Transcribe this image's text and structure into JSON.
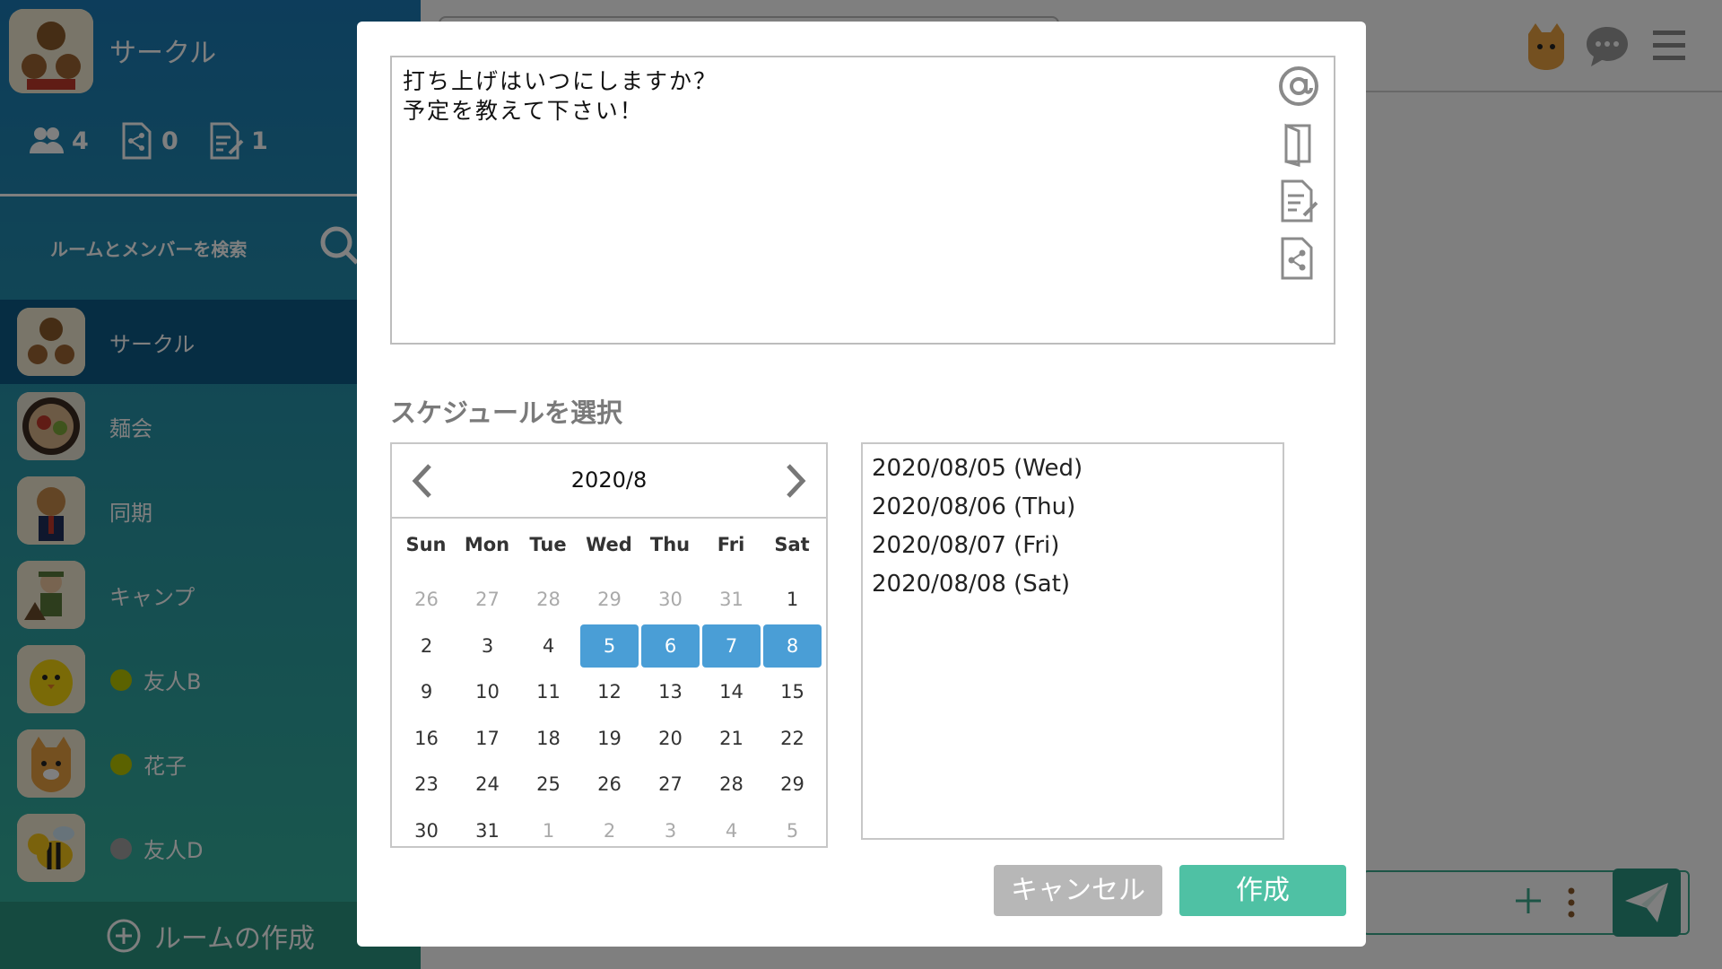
{
  "sidebar": {
    "circle_name": "サークル",
    "stats": {
      "members": "4",
      "shared_files": "0",
      "notes": "1"
    },
    "search_placeholder": "ルームとメンバーを検索",
    "rooms": [
      {
        "name": "サークル",
        "active": true,
        "icon": "bears-avatar"
      },
      {
        "name": "麺会",
        "active": false,
        "icon": "ramen-avatar"
      },
      {
        "name": "同期",
        "active": false,
        "icon": "dog-avatar"
      },
      {
        "name": "キャンプ",
        "active": false,
        "icon": "camper-avatar"
      },
      {
        "name": "友人B",
        "active": false,
        "icon": "chick-avatar",
        "status": "online"
      },
      {
        "name": "花子",
        "active": false,
        "icon": "cat-avatar",
        "status": "online"
      },
      {
        "name": "友人D",
        "active": false,
        "icon": "bee-avatar",
        "status": "offline"
      }
    ],
    "create_room_label": "ルームの作成"
  },
  "colors": {
    "accent_green": "#4fc1a4",
    "selected_blue": "#4a9ed6",
    "status_online": "#b7c400",
    "status_offline": "#a0a0a0"
  },
  "modal": {
    "message": "打ち上げはいつにしますか？\n予定を教えて下さい！",
    "tools": [
      "mention-icon",
      "exit-door-icon",
      "note-edit-icon",
      "share-file-icon"
    ],
    "schedule_heading": "スケジュールを選択",
    "calendar": {
      "month_label": "2020/8",
      "weekdays": [
        "Sun",
        "Mon",
        "Tue",
        "Wed",
        "Thu",
        "Fri",
        "Sat"
      ],
      "weeks": [
        [
          "26",
          "27",
          "28",
          "29",
          "30",
          "31",
          "1"
        ],
        [
          "2",
          "3",
          "4",
          "5",
          "6",
          "7",
          "8"
        ],
        [
          "9",
          "10",
          "11",
          "12",
          "13",
          "14",
          "15"
        ],
        [
          "16",
          "17",
          "18",
          "19",
          "20",
          "21",
          "22"
        ],
        [
          "23",
          "24",
          "25",
          "26",
          "27",
          "28",
          "29"
        ],
        [
          "30",
          "31",
          "1",
          "2",
          "3",
          "4",
          "5"
        ]
      ],
      "selected_days": [
        "5",
        "6",
        "7",
        "8"
      ]
    },
    "selected_dates": [
      "2020/08/05 (Wed)",
      "2020/08/06 (Thu)",
      "2020/08/07 (Fri)",
      "2020/08/08 (Sat)"
    ],
    "cancel_label": "キャンセル",
    "create_label": "作成"
  }
}
